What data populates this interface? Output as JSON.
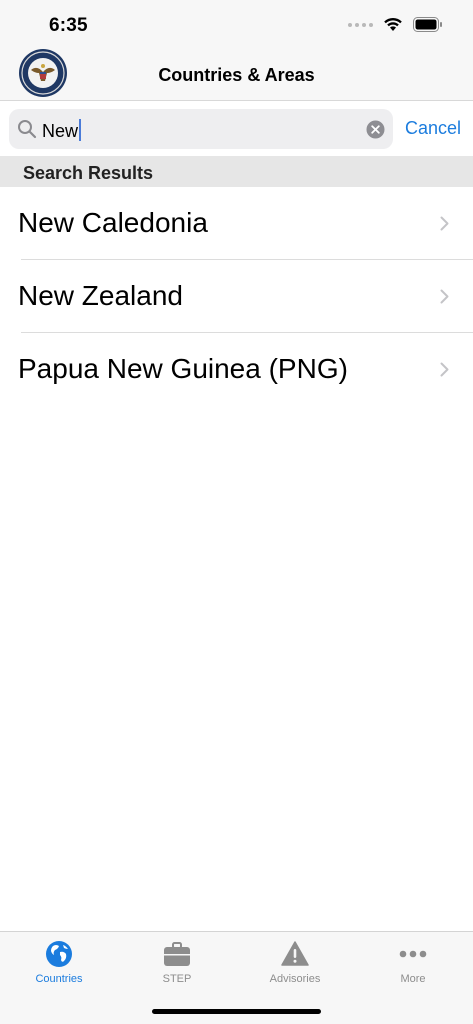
{
  "status_bar": {
    "time": "6:35",
    "icons": [
      "signal-dots-icon",
      "wifi-icon",
      "battery-icon"
    ]
  },
  "nav": {
    "title": "Countries & Areas",
    "logo_icon": "department-seal-icon"
  },
  "search": {
    "value": "New",
    "cancel_label": "Cancel"
  },
  "section": {
    "title": "Search Results"
  },
  "results": [
    {
      "label": "New Caledonia"
    },
    {
      "label": "New Zealand"
    },
    {
      "label": "Papua New Guinea (PNG)"
    }
  ],
  "tabs": [
    {
      "label": "Countries",
      "icon": "globe-icon",
      "active": true
    },
    {
      "label": "STEP",
      "icon": "briefcase-icon",
      "active": false
    },
    {
      "label": "Advisories",
      "icon": "warning-icon",
      "active": false
    },
    {
      "label": "More",
      "icon": "more-icon",
      "active": false
    }
  ],
  "colors": {
    "accent": "#1b7cde",
    "inactive_tab": "#8d8d8d",
    "bar_background": "#f7f7f7",
    "section_background": "#e6e6e6"
  }
}
